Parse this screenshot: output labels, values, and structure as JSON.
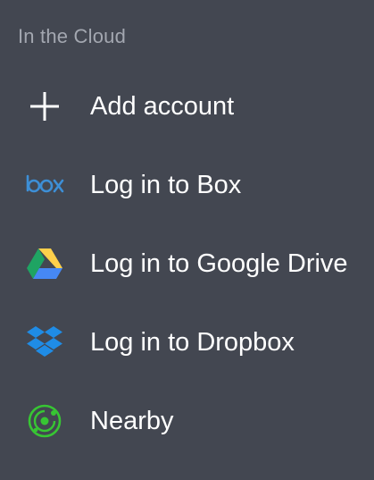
{
  "section": {
    "title": "In the Cloud"
  },
  "items": [
    {
      "label": "Add account",
      "icon": "plus-icon"
    },
    {
      "label": "Log in to Box",
      "icon": "box-logo-icon"
    },
    {
      "label": "Log in to Google Drive",
      "icon": "google-drive-logo-icon"
    },
    {
      "label": "Log in to Dropbox",
      "icon": "dropbox-logo-icon"
    },
    {
      "label": "Nearby",
      "icon": "nearby-radar-icon"
    }
  ],
  "colors": {
    "background": "#434751",
    "header_text": "#a3a7b0",
    "item_text": "#ffffff",
    "box_blue": "#3d8fd6",
    "dropbox_blue": "#1f8ce6",
    "nearby_green": "#37c633",
    "drive_green": "#1fa463",
    "drive_yellow": "#ffd04b",
    "drive_blue": "#4688f4"
  }
}
